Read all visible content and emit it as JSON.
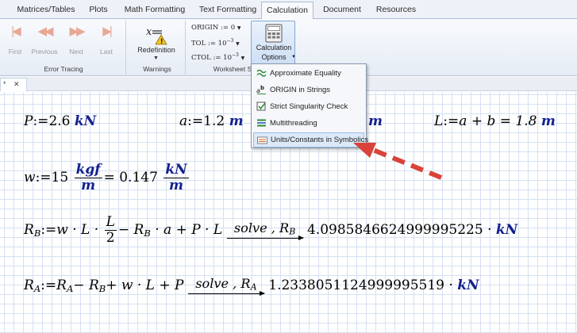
{
  "tabs": [
    "Matrices/Tables",
    "Plots",
    "Math Formatting",
    "Text Formatting",
    "Calculation",
    "Document",
    "Resources"
  ],
  "active_tab": "Calculation",
  "ribbon": {
    "error_tracing": {
      "first": "First",
      "previous": "Previous",
      "next": "Next",
      "last": "Last",
      "group_label": "Error Tracing"
    },
    "warnings": {
      "redefinition": "Redefinition",
      "group_label": "Warnings"
    },
    "worksheet_settings": {
      "origin": "ORIGIN :=  0",
      "tol": "TOL :=  10",
      "tol_exp": "−3",
      "ctol": "CTOL :=  10",
      "ctol_exp": "−3",
      "group_label": "Worksheet S"
    },
    "calculation_options": {
      "line1": "Calculation",
      "line2": "Options"
    }
  },
  "doc_tab": {
    "label": "*",
    "close": "✕"
  },
  "menu": {
    "items": [
      {
        "label": "Approximate Equality",
        "icon": "approx-icon"
      },
      {
        "label": "ORIGIN in Strings",
        "icon": "ab-icon"
      },
      {
        "label": "Strict Singularity Check",
        "icon": "check-icon"
      },
      {
        "label": "Multithreading",
        "icon": "threads-icon"
      },
      {
        "label": "Units/Constants in Symbolics",
        "icon": "units-icon"
      }
    ],
    "highlighted": "Units/Constants in Symbolics"
  },
  "equations": {
    "p_lhs": "P",
    "assign": ":=",
    "p_val": "2.6",
    "p_unit": "kN",
    "a_lhs": "a",
    "a_val": "1.2",
    "a_unit": "m",
    "b_unit_visible": "m",
    "l_lhs": "L",
    "l_rhs": "a + b = 1.8",
    "l_unit": "m",
    "w_lhs": "w",
    "w_val": "15",
    "w_num": "kgf",
    "w_den": "m",
    "w_eq": "= 0.147",
    "w_num2": "kN",
    "w_den2": "m",
    "rb_lhs": "R",
    "rb_sub": "B",
    "rb_expr1": "w · L ·",
    "rb_frac_num": "L",
    "rb_frac_den": "2",
    "rb_expr2": "− R",
    "rb_expr3": "· a + P · L",
    "rb_solve": "solve , R",
    "rb_solve_sub": "B",
    "rb_result": "4.0985846624999995225 ·",
    "rb_unit": "kN",
    "ra_lhs": "R",
    "ra_sub": "A",
    "ra_expr1": "R",
    "ra_expr2": "− R",
    "ra_expr3": "+ w · L + P",
    "ra_solve": "solve , R",
    "ra_solve_sub": "A",
    "ra_result": "1.2338051124999995519 ·",
    "ra_unit": "kN"
  }
}
